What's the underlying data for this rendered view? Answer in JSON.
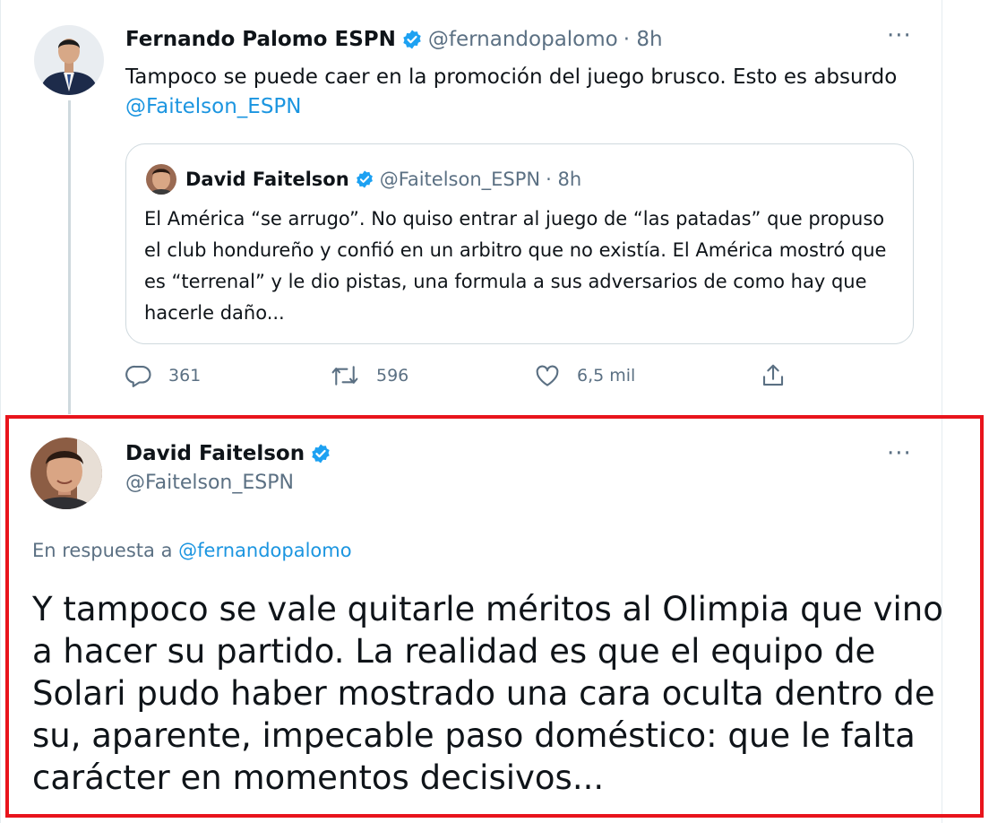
{
  "parent_tweet": {
    "author_name": "Fernando Palomo ESPN",
    "author_handle": "@fernandopalomo",
    "time": "· 8h",
    "text": "Tampoco se puede caer en la promoción del juego brusco. Esto es absurdo",
    "mention": "@Faitelson_ESPN",
    "more_label": "···",
    "quoted": {
      "author_name": "David Faitelson",
      "author_handle": "@Faitelson_ESPN",
      "time": "· 8h",
      "text": "El América “se arrugo”. No quiso entrar al juego de “las patadas” que propuso el club hondureño y confió en un arbitro que no existía.  El América mostró que es “terrenal” y le dio pistas, una formula a sus adversarios de como hay que hacerle daño..."
    },
    "actions": {
      "replies": "361",
      "retweets": "596",
      "likes": "6,5 mil"
    }
  },
  "reply_tweet": {
    "author_name": "David Faitelson",
    "author_handle": "@Faitelson_ESPN",
    "more_label": "···",
    "reply_to_prefix": "En respuesta a",
    "reply_to_handle": "@fernandopalomo",
    "text": "Y tampoco se vale quitarle méritos al Olimpia que vino a hacer su partido. La realidad es que el equipo de Solari pudo haber mostrado una cara oculta dentro de su, aparente, impecable paso doméstico: que le falta carácter en momentos decisivos..."
  },
  "icons": {
    "verified": "verified-badge-icon",
    "reply": "reply-icon",
    "retweet": "retweet-icon",
    "like": "heart-icon",
    "share": "share-icon",
    "more": "more-icon"
  },
  "colors": {
    "highlight_border": "#e8141c",
    "link": "#1b95e0",
    "verified": "#1da1f2",
    "secondary_text": "#5b7083"
  }
}
